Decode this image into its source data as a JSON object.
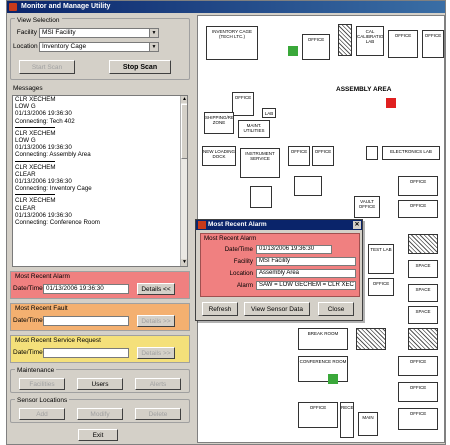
{
  "window": {
    "title": "Monitor and Manage Utility"
  },
  "view_selection": {
    "title": "View Selection",
    "facility_label": "Facility",
    "facility_value": "MSI Facility",
    "location_label": "Location",
    "location_value": "Inventory Cage",
    "start_scan": "Start Scan",
    "stop_scan": "Stop Scan"
  },
  "messages": {
    "title": "Messages",
    "lines": [
      "CLR XECHEM",
      "LOW G",
      "01/13/2006 19:36:30",
      "Connecting: Tech 402",
      "---",
      "CLR XECHEM",
      "LOW G",
      "01/13/2006 19:36:30",
      "Connecting: Assembly Area",
      "---",
      "CLR XECHEM",
      "CLEAR",
      "01/13/2006 19:36:30",
      "Connecting: Inventory Cage",
      "---",
      "CLR XECHEM",
      "CLEAR",
      "01/13/2006 19:36:30",
      "Connecting: Conference Room"
    ]
  },
  "recent_alarm": {
    "title": "Most Recent Alarm",
    "date_label": "Date/Time",
    "date_value": "01/13/2006 19:36:30",
    "details_button": "Details <<",
    "color": "#f08080"
  },
  "recent_fault": {
    "title": "Most Recent Fault",
    "date_label": "Date/Time",
    "date_value": "",
    "details_button": "Details >>",
    "color": "#f4b070"
  },
  "recent_service": {
    "title": "Most Recent Service Request",
    "date_label": "Date/Time",
    "date_value": "",
    "details_button": "Details >>",
    "color": "#f4e07a"
  },
  "maintenance": {
    "title": "Maintenance",
    "facilities": "Facilities",
    "users": "Users",
    "alerts": "Alerts"
  },
  "sensor_locations": {
    "title": "Sensor Locations",
    "add": "Add",
    "modify": "Modify",
    "delete": "Delete"
  },
  "exit_button": "Exit",
  "map": {
    "rooms": {
      "inventory_cage": "INVENTORY CAGE (TECH LTC.)",
      "office": "OFFICE",
      "cal_lab": "CAL CALIBRATION LAB",
      "window": "WINDOW",
      "assembly_area": "ASSEMBLY AREA",
      "shipping": "SHIPPING/RECEIVING ZONE",
      "lab": "LAB",
      "maint": "MAINT. UTILITIES",
      "new_loading": "NEW LOADING DOCK",
      "instrument": "INSTRUMENT SERVICE",
      "electronics": "ELECTRONICS LAB",
      "break": "BREAK ROOM",
      "conference": "CONFERENCE ROOM",
      "womens": "WOMEN'S RESTROOM",
      "mens": "MEN'S RESTROOM",
      "utility": "UTILITY ROOM",
      "vault": "VAULT OFFICE",
      "space": "SPACE",
      "test": "TEST LAB",
      "reception": "RECEPTION",
      "main": "MAIN"
    },
    "sensor_green": "#3aa83a",
    "sensor_red": "#e02020"
  },
  "popup": {
    "title": "Most Recent Alarm",
    "group_title": "Most Recent Alarm",
    "date_label": "Date/Time",
    "date_value": "01/13/2006 19:36:30",
    "facility_label": "Facility",
    "facility_value": "MSI Facility",
    "location_label": "Location",
    "location_value": "Assembly Area",
    "alarm_label": "Alarm",
    "alarm_value": "SAW = LOW GECHEM = CLR XEC",
    "refresh": "Refresh",
    "view_sensor": "View Sensor Data",
    "close": "Close"
  }
}
